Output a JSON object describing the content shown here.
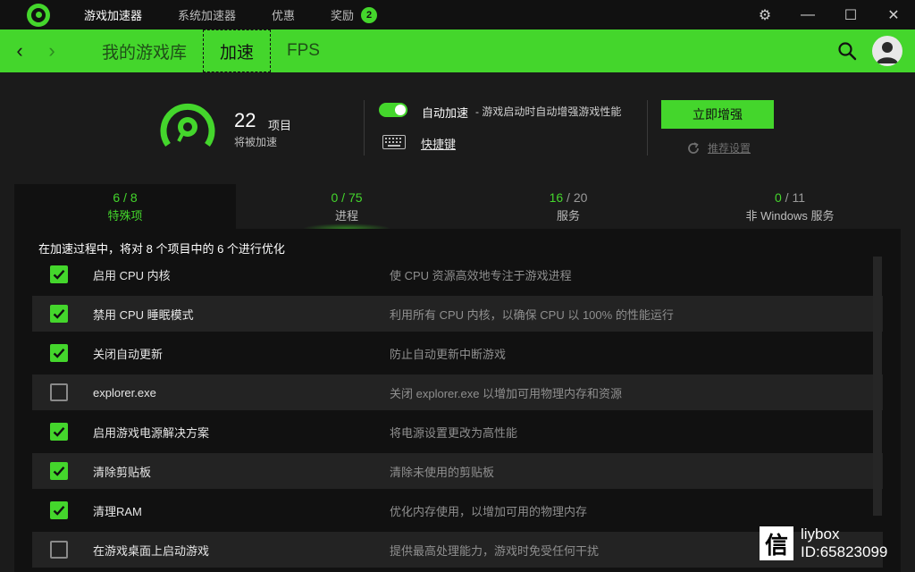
{
  "titlebar": {
    "tabs": [
      {
        "label": "游戏加速器"
      },
      {
        "label": "系统加速器"
      },
      {
        "label": "优惠"
      },
      {
        "label": "奖励",
        "badge": "2"
      }
    ],
    "controls": {
      "settings": "⚙",
      "minimize": "—",
      "maximize": "☐",
      "close": "✕"
    }
  },
  "nav": {
    "back": "‹",
    "forward": "›",
    "tabs": [
      "我的游戏库",
      "加速",
      "FPS"
    ],
    "active_tab": "加速"
  },
  "summary": {
    "count": "22",
    "unit": "项目",
    "sub": "将被加速",
    "auto_label": "自动加速",
    "auto_desc": "- 游戏启动时自动增强游戏性能",
    "auto_enabled": true,
    "shortcut": "快捷键",
    "boost_button": "立即增强",
    "recommend": "推荐设置"
  },
  "categories": [
    {
      "done": "6",
      "total": "8",
      "sep": " / ",
      "name": "特殊项"
    },
    {
      "done": "0",
      "total": "75",
      "sep": " / ",
      "name": "进程"
    },
    {
      "done": "16",
      "total": "20",
      "sep": " / ",
      "name": "服务"
    },
    {
      "done": "0",
      "total": "11",
      "sep": " / ",
      "name": "非 Windows 服务"
    }
  ],
  "panel": {
    "heading": "在加速过程中，将对 8 个项目中的 6 个进行优化",
    "rows": [
      {
        "name": "启用 CPU 内核",
        "desc": "使 CPU 资源高效地专注于游戏进程",
        "checked": true
      },
      {
        "name": "禁用 CPU 睡眠模式",
        "desc": "利用所有 CPU 内核，以确保 CPU 以 100% 的性能运行",
        "checked": true
      },
      {
        "name": "关闭自动更新",
        "desc": "防止自动更新中断游戏",
        "checked": true
      },
      {
        "name": "explorer.exe",
        "desc": "关闭 explorer.exe 以增加可用物理内存和资源",
        "checked": false
      },
      {
        "name": "启用游戏电源解决方案",
        "desc": "将电源设置更改为高性能",
        "checked": true
      },
      {
        "name": "清除剪贴板",
        "desc": "清除未使用的剪贴板",
        "checked": true
      },
      {
        "name": "清理RAM",
        "desc": "优化内存使用，以增加可用的物理内存",
        "checked": true
      },
      {
        "name": "在游戏桌面上启动游戏",
        "desc": "提供最高处理能力，游戏时免受任何干扰",
        "checked": false
      }
    ]
  },
  "watermark": {
    "glyph": "信",
    "line1": "liybox",
    "line2": "ID:65823099"
  },
  "colors": {
    "accent": "#44d62c",
    "bg": "#1b1b1b",
    "panel": "#111111"
  }
}
